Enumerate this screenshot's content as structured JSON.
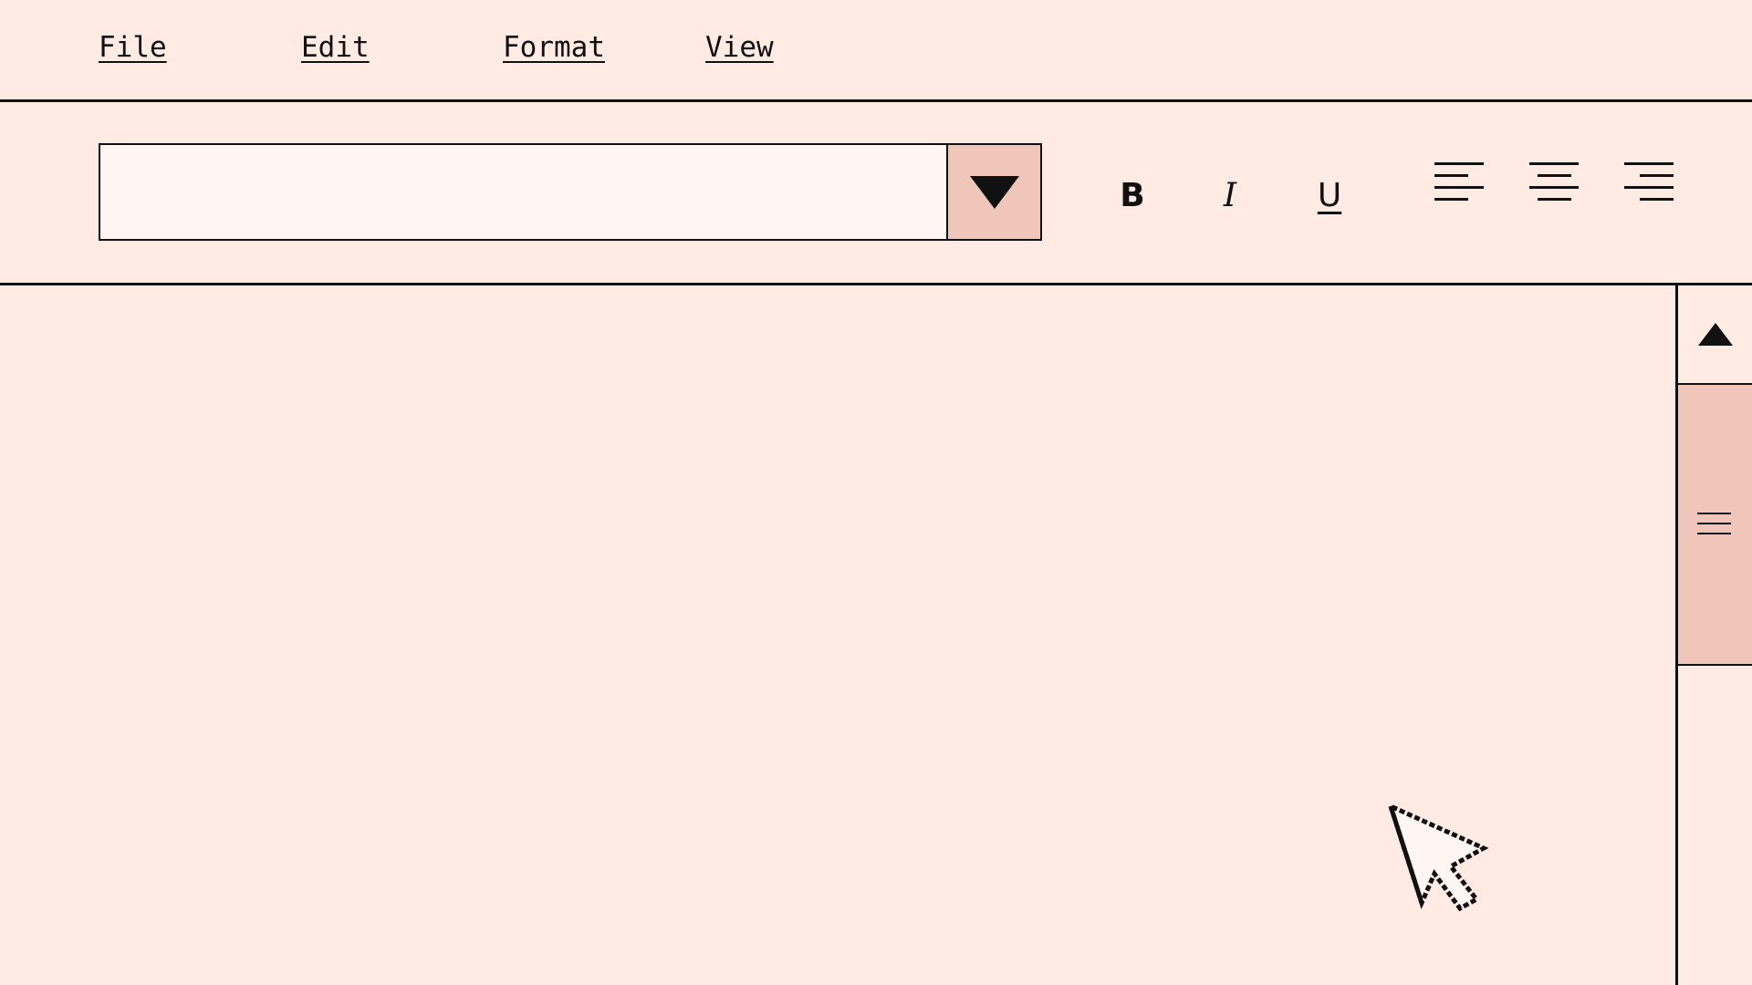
{
  "menu": {
    "file": "File",
    "edit": "Edit",
    "format": "Format",
    "view": "View"
  },
  "toolbar": {
    "font_input_value": "",
    "font_dropdown_icon": "chevron-down-icon",
    "bold_label": "B",
    "italic_label": "I",
    "underline_label": "U",
    "align_left_icon": "align-left-icon",
    "align_center_icon": "align-center-icon",
    "align_right_icon": "align-right-icon"
  },
  "document": {
    "content": ""
  },
  "scrollbar": {
    "up_icon": "arrow-up-icon",
    "thumb_grip_icon": "grip-icon"
  },
  "colors": {
    "background": "#FFEBE4",
    "accent": "#F1C6BA",
    "input_background": "#FFF5F2",
    "ink": "#111111"
  }
}
